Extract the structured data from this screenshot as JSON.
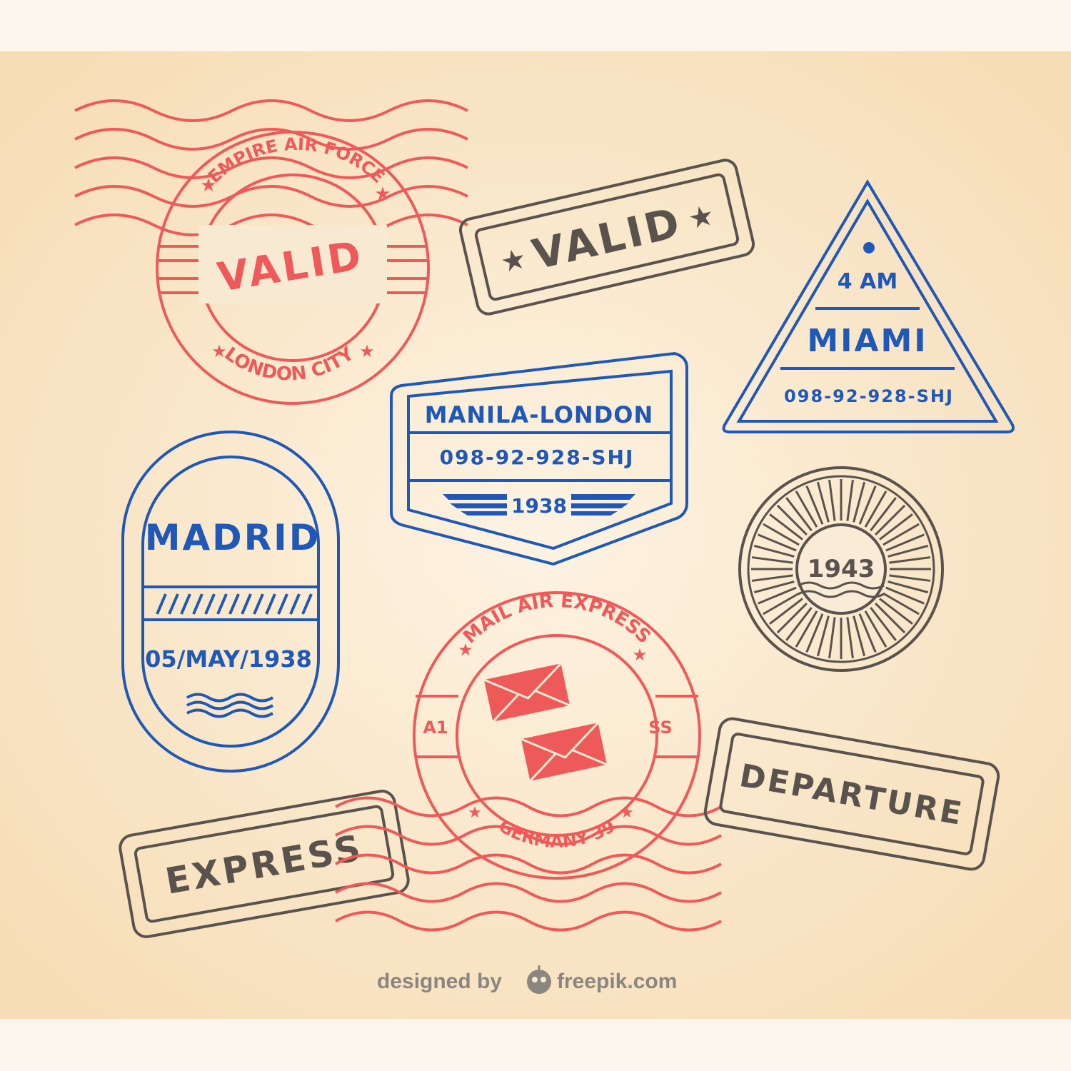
{
  "colors": {
    "paper_top": "#fbf5ec",
    "paper": "#f7e4c6",
    "red": "#ee5a5a",
    "blue": "#1f58b8",
    "gray": "#5a524d",
    "credit": "#8c8680"
  },
  "stamps": {
    "empire": {
      "top_arc": "EMPIRE AIR FORCE",
      "center": "VALID",
      "bottom_arc": "LONDON CITY",
      "icon": "star-icon"
    },
    "valid_rect": {
      "label": "VALID",
      "icon": "star-icon"
    },
    "miami": {
      "time": "4 AM",
      "city": "MIAMI",
      "code": "098-92-928-SHJ"
    },
    "manila": {
      "route": "MANILA-LONDON",
      "code": "098-92-928-SHJ",
      "year": "1938"
    },
    "madrid": {
      "city": "MADRID",
      "date": "05/MAY/1938"
    },
    "year_1943": {
      "year": "1943"
    },
    "mail": {
      "top_arc": "MAIL AIR EXPRESS",
      "left": "A1",
      "right": "SS",
      "bottom_arc": "GERMANY 39",
      "icon": "envelope-icon"
    },
    "departure": {
      "label": "DEPARTURE"
    },
    "express": {
      "label": "EXPRESS"
    }
  },
  "credit": {
    "prefix": "designed by",
    "brand": "freepik.com",
    "icon": "freepik-logo-icon"
  }
}
